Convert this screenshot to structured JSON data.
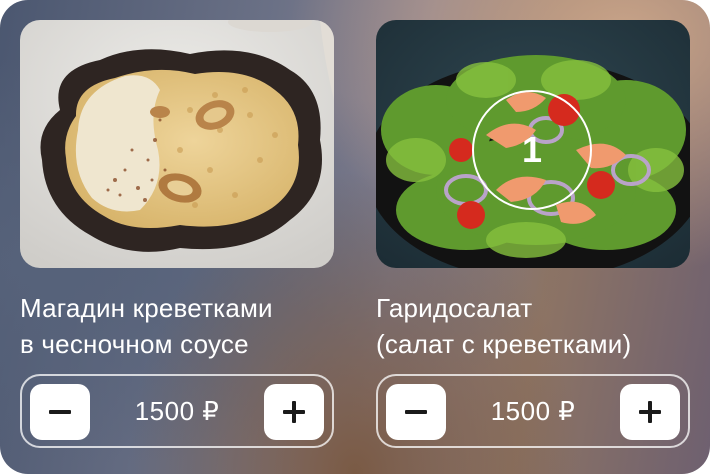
{
  "items": [
    {
      "title_line1": "Магадин креветками",
      "title_line2": "в чесночном соусе",
      "price": "1500 ₽",
      "image_icon": "risotto-dish-photo"
    },
    {
      "title_line1": "Гаридосалат",
      "title_line2": "(салат с креветками)",
      "price": "1500 ₽",
      "quantity_in_cart": "1",
      "image_icon": "shrimp-salad-photo"
    }
  ],
  "controls": {
    "decrement_icon": "minus-icon",
    "increment_icon": "plus-icon"
  },
  "colors": {
    "text": "#ffffff",
    "button_bg": "#ffffff",
    "icon": "#1a1a1a"
  }
}
